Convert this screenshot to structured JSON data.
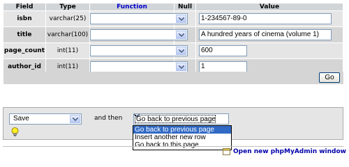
{
  "table": {
    "headers": {
      "field": "Field",
      "type": "Type",
      "function": "Function",
      "null": "Null",
      "value": "Value"
    },
    "rows": [
      {
        "field": "isbn",
        "type": "varchar(25)",
        "function": "",
        "value": "1-234567-89-0"
      },
      {
        "field": "title",
        "type": "varchar(100)",
        "function": "",
        "value": "A hundred years of cinema (volume 1)"
      },
      {
        "field": "page_count",
        "type": "int(11)",
        "function": "",
        "value": "600"
      },
      {
        "field": "author_id",
        "type": "int(11)",
        "function": "",
        "value": "1"
      }
    ],
    "go_label": "Go"
  },
  "action": {
    "save_selected": "Save",
    "and_then": "and then",
    "after_selected": "Go back to previous page",
    "options": [
      "Go back to previous page",
      "Insert another new row",
      "Go back to this page"
    ]
  },
  "footer": {
    "link": "Open new phpMyAdmin window"
  },
  "colors": {
    "header_bg": "#d1d5d7",
    "row_odd": "#e5e5e5",
    "row_even": "#d5d5d5",
    "selected_option": "#316ac5",
    "link": "#0000aa"
  },
  "icons": {
    "select_arrow": "chevron-down-icon",
    "hint": "lightbulb-icon",
    "new_window": "new-window-icon"
  }
}
